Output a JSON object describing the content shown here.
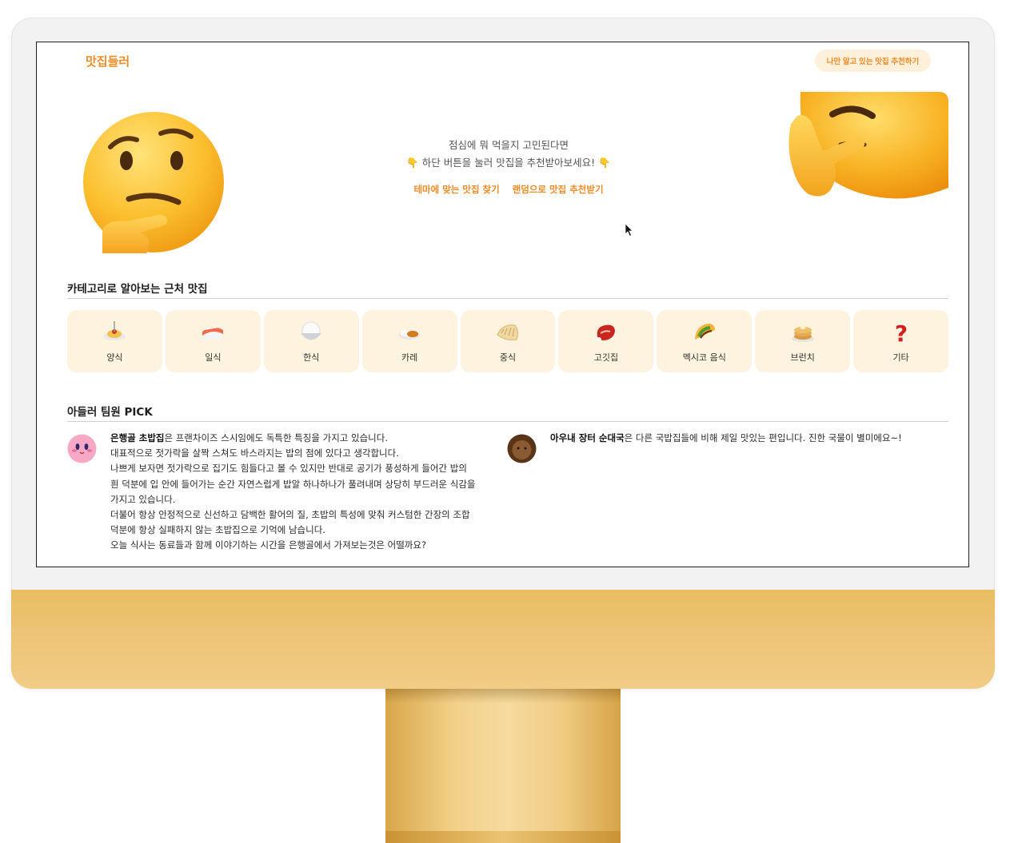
{
  "app": {
    "logo": "맛집들러",
    "recommend_button": "나만 알고 있는 맛집 추천하기"
  },
  "hero": {
    "line1": "점심에 뭐 먹을지 고민된다면",
    "line2": "👇 하단 버튼을 눌러 맛집을 추천받아보세요! 👇",
    "link_theme": "테마에 맞는 맛집 찾기",
    "link_random": "랜덤으로 맛집 추천받기"
  },
  "categories": {
    "title": "카테고리로 알아보는 근처 맛집",
    "items": [
      {
        "label": "양식",
        "icon": "spaghetti-icon"
      },
      {
        "label": "일식",
        "icon": "sushi-icon"
      },
      {
        "label": "한식",
        "icon": "rice-bowl-icon"
      },
      {
        "label": "카레",
        "icon": "curry-icon"
      },
      {
        "label": "중식",
        "icon": "dumpling-icon"
      },
      {
        "label": "고깃집",
        "icon": "meat-icon"
      },
      {
        "label": "멕시코 음식",
        "icon": "taco-icon"
      },
      {
        "label": "브런치",
        "icon": "pancakes-icon"
      },
      {
        "label": "기타",
        "icon": "question-icon"
      }
    ]
  },
  "picks": {
    "title": "아들러 팀원 PICK",
    "items": [
      {
        "place": "은행골 초밥집",
        "lines": [
          "은 프랜차이즈 스시임에도 독특한 특징을 가지고 있습니다.",
          "대표적으로 젓가락을 살짝 스쳐도 바스라지는 밥의 점에 있다고 생각합니다.",
          "나쁘게 보자면 젓가락으로 집기도 힘들다고 볼 수 있지만 반대로 공기가 풍성하게 들어간 밥의",
          "흰 덕분에 입 안에 들어가는 순간 자연스럽게 밥알 하나하나가 풀려내며 상당히 부드러운 식감을",
          "가지고 있습니다.",
          "더불어 항상 안정적으로 신선하고 담백한 활어의 질, 초밥의 특성에 맞춰 커스텀한 간장의 조합",
          "덕분에 항상 실패하지 않는 초밥집으로 기억에 남습니다.",
          "오늘 식사는 동료들과 함께 이야기하는 시간을 은행골에서 가져보는것은 어떨까요?"
        ]
      },
      {
        "place": "아우내 장터 순대국",
        "lines": [
          "은 다른 국밥집들에 비해 제일 맛있는 편입니다. 진한 국물이 별미에요~!"
        ]
      }
    ]
  },
  "colors": {
    "accent": "#f08a24",
    "category_bg": "#fdf3de",
    "chin": "#eec57a"
  }
}
